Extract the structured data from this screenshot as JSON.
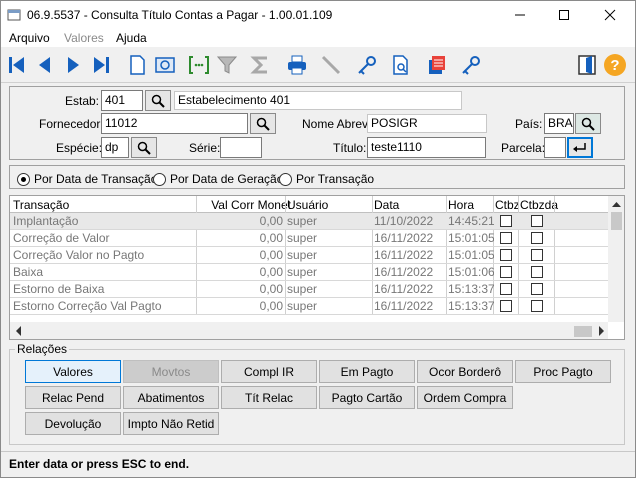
{
  "window": {
    "title": "06.9.5537 - Consulta Título Contas a Pagar - 1.00.01.109"
  },
  "menu": [
    "Arquivo",
    "Valores",
    "Ajuda"
  ],
  "toolbar": {
    "icons": [
      "first-icon",
      "previous-icon",
      "next-icon",
      "last-icon",
      "new-document-icon",
      "view-icon",
      "select-icon",
      "filter-icon",
      "sum-icon",
      "print-icon",
      "edit-icon",
      "key-icon",
      "preview-icon",
      "report-icon",
      "key-2-icon",
      "exit-icon",
      "help-icon"
    ],
    "help_label": "?"
  },
  "form": {
    "estab_label": "Estab:",
    "estab_value": "401",
    "estab_desc": "Estabelecimento 401",
    "fornecedor_label": "Fornecedor:",
    "fornecedor_value": "11012",
    "nome_abrev_label": "Nome Abrev:",
    "nome_abrev_value": "POSIGR",
    "pais_label": "País:",
    "pais_value": "BRA",
    "especie_label": "Espécie:",
    "especie_value": "dp",
    "serie_label": "Série:",
    "serie_value": "",
    "titulo_label": "Título:",
    "titulo_value": "teste1110",
    "parcela_label": "Parcela:",
    "parcela_value": ""
  },
  "radios": [
    {
      "label": "Por Data de Transação",
      "selected": true
    },
    {
      "label": "Por Data de Geração",
      "selected": false
    },
    {
      "label": "Por Transação",
      "selected": false
    }
  ],
  "table": {
    "headers": [
      "Transação",
      "Val Corr Monet",
      "Usuário",
      "Data",
      "Hora",
      "Ctbz",
      "Ctbzda"
    ],
    "rows": [
      {
        "transacao": "Implantação",
        "val": "0,00",
        "usuario": "super",
        "data": "11/10/2022",
        "hora": "14:45:21"
      },
      {
        "transacao": "Correção de Valor",
        "val": "0,00",
        "usuario": "super",
        "data": "16/11/2022",
        "hora": "15:01:05"
      },
      {
        "transacao": "Correção Valor no Pagto",
        "val": "0,00",
        "usuario": "super",
        "data": "16/11/2022",
        "hora": "15:01:05"
      },
      {
        "transacao": "Baixa",
        "val": "0,00",
        "usuario": "super",
        "data": "16/11/2022",
        "hora": "15:01:06"
      },
      {
        "transacao": "Estorno de Baixa",
        "val": "0,00",
        "usuario": "super",
        "data": "16/11/2022",
        "hora": "15:13:37"
      },
      {
        "transacao": "Estorno Correção Val Pagto",
        "val": "0,00",
        "usuario": "super",
        "data": "16/11/2022",
        "hora": "15:13:37"
      }
    ]
  },
  "relacoes": {
    "legend": "Relações",
    "buttons": [
      [
        "Valores",
        "Movtos",
        "Compl IR",
        "Em Pagto",
        "Ocor Borderô",
        "Proc Pagto"
      ],
      [
        "Relac Pend",
        "Abatimentos",
        "Tít  Relac",
        "Pagto Cartão",
        "Ordem Compra"
      ],
      [
        "Devolução",
        "Impto Não Retid"
      ]
    ]
  },
  "status": {
    "text": "Enter data or press ESC to end."
  },
  "colors": {
    "accent": "#0078d7",
    "toolbar_icon": "#1560bd"
  }
}
